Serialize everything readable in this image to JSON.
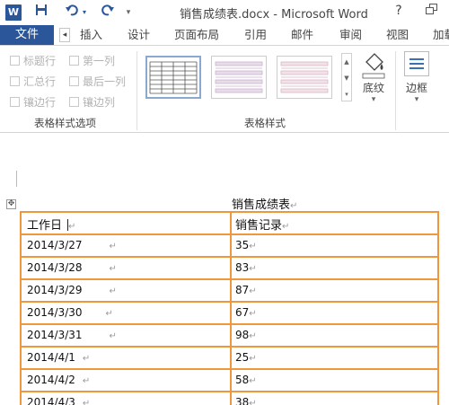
{
  "titlebar": {
    "app_badge": "W",
    "title": "销售成绩表.docx - Microsoft Word",
    "help": "?"
  },
  "ribbon_tabs": {
    "file": "文件",
    "items": [
      "插入",
      "设计",
      "页面布局",
      "引用",
      "邮件",
      "审阅",
      "视图",
      "加载"
    ]
  },
  "style_options": {
    "checkboxes": [
      "标题行",
      "第一列",
      "汇总行",
      "最后一列",
      "镶边行",
      "镶边列"
    ],
    "group_label": "表格样式选项"
  },
  "table_styles": {
    "group_label": "表格样式"
  },
  "shading": {
    "label": "底纹",
    "arrow": "▾"
  },
  "borders": {
    "label": "边框",
    "arrow": "▾"
  },
  "document": {
    "title": "销售成绩表",
    "paragraph_mark": "↵",
    "table": {
      "headers": [
        "工作日",
        "销售记录"
      ],
      "rows": [
        [
          "2014/3/27",
          "35"
        ],
        [
          "2014/3/28",
          "83"
        ],
        [
          "2014/3/29",
          "87"
        ],
        [
          "2014/3/30",
          "67"
        ],
        [
          "2014/3/31",
          "98"
        ],
        [
          "2014/4/1",
          "25"
        ],
        [
          "2014/4/2",
          "58"
        ],
        [
          "2014/4/3",
          "38"
        ]
      ]
    }
  },
  "colors": {
    "brand": "#2b579a",
    "table_border": "#f0963c"
  }
}
